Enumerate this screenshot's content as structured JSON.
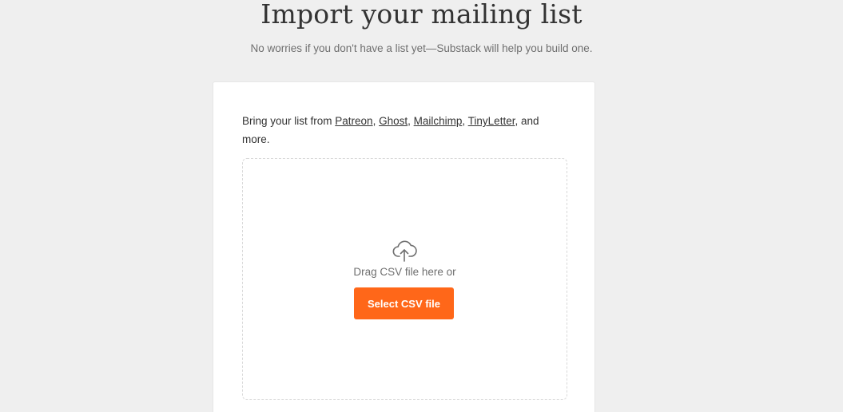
{
  "header": {
    "title": "Import your mailing list",
    "subtitle": "No worries if you don't have a list yet—Substack will help you build one."
  },
  "card": {
    "intro_prefix": "Bring your list from ",
    "sources": [
      {
        "label": "Patreon"
      },
      {
        "label": "Ghost"
      },
      {
        "label": "Mailchimp"
      },
      {
        "label": "TinyLetter"
      }
    ],
    "separator": ", ",
    "intro_suffix": ", and more."
  },
  "dropzone": {
    "icon": "cloud-upload-icon",
    "drag_text": "Drag CSV file here or",
    "button_label": "Select CSV file"
  },
  "colors": {
    "accent": "#ff6719",
    "background": "#efefef",
    "card": "#ffffff"
  }
}
